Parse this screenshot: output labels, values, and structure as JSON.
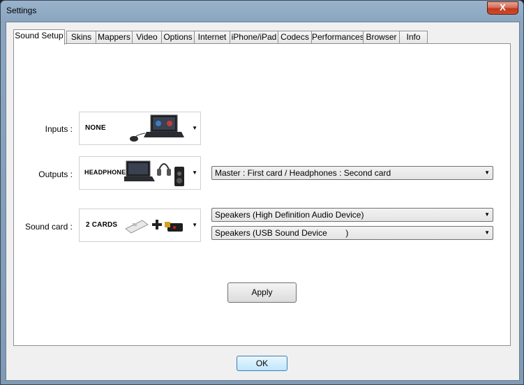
{
  "window": {
    "title": "Settings",
    "close_glyph": "X"
  },
  "tabs": [
    {
      "label": "Sound Setup",
      "active": true
    },
    {
      "label": "Skins"
    },
    {
      "label": "Mappers"
    },
    {
      "label": "Video"
    },
    {
      "label": "Options"
    },
    {
      "label": "Internet"
    },
    {
      "label": "iPhone/iPad"
    },
    {
      "label": "Codecs"
    },
    {
      "label": "Performances"
    },
    {
      "label": "Browser"
    },
    {
      "label": "Info"
    }
  ],
  "sound_setup": {
    "inputs": {
      "label": "Inputs :",
      "value": "NONE"
    },
    "outputs": {
      "label": "Outputs :",
      "value": "HEADPHONES",
      "mode": "Master : First card / Headphones : Second card"
    },
    "sound_card": {
      "label": "Sound card :",
      "value": "2 CARDS",
      "card1": "Speakers (High Definition Audio Device)",
      "card2": "Speakers (USB Sound Device        )"
    },
    "apply_label": "Apply"
  },
  "footer": {
    "ok_label": "OK"
  },
  "icons": {
    "dropdown": "triangle-down",
    "laptop": "laptop-icon",
    "mouse": "mouse-icon",
    "headphones": "headphones-icon",
    "speaker": "speaker-icon",
    "usb": "usb-icon",
    "plus": "plus-icon"
  },
  "colors": {
    "close_red": "#c0391f",
    "frame": "#8aa5c0"
  }
}
